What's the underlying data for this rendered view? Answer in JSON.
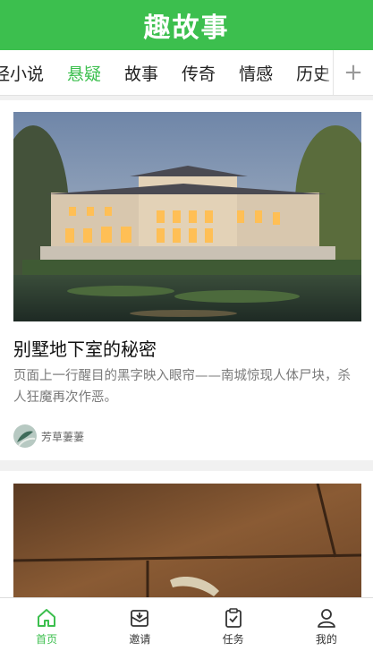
{
  "app": {
    "title": "趣故事",
    "brand_color": "#3cbf4e"
  },
  "tabs": [
    {
      "label": "经小说",
      "active": false
    },
    {
      "label": "悬疑",
      "active": true
    },
    {
      "label": "故事",
      "active": false
    },
    {
      "label": "传奇",
      "active": false
    },
    {
      "label": "情感",
      "active": false
    },
    {
      "label": "历史",
      "active": false
    }
  ],
  "tab_add_label": "+",
  "articles": [
    {
      "image": "mansion-photo",
      "title": "别墅地下室的秘密",
      "summary": "页面上一行醒目的黑字映入眼帘——南城惊现人体尸块，杀人狂魔再次作恶。",
      "author": "芳草萋萋",
      "avatar": "avatar-image"
    },
    {
      "image": "wooden-floor-photo"
    }
  ],
  "bottom_nav": [
    {
      "label": "首页",
      "icon": "home-icon",
      "active": true
    },
    {
      "label": "邀请",
      "icon": "invite-icon",
      "active": false
    },
    {
      "label": "任务",
      "icon": "task-icon",
      "active": false
    },
    {
      "label": "我的",
      "icon": "profile-icon",
      "active": false
    }
  ]
}
